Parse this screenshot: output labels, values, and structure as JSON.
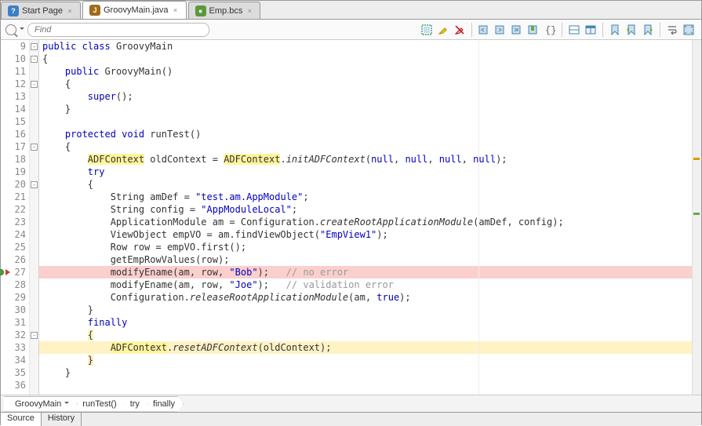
{
  "tabs": [
    {
      "label": "Start Page",
      "icon": "q",
      "active": false
    },
    {
      "label": "GroovyMain.java",
      "icon": "j",
      "active": true
    },
    {
      "label": "Emp.bcs",
      "icon": "g",
      "active": false
    }
  ],
  "find": {
    "placeholder": "Find"
  },
  "toolbar_icons": [
    "block-select",
    "highlight",
    "clear-highlight",
    "|",
    "nav-back",
    "nav-forward",
    "nav-last",
    "bookmark-toggle",
    "braces",
    "|",
    "split-h",
    "split-v",
    "|",
    "bookmark",
    "bm-prev",
    "bm-next",
    "|",
    "line-wrap",
    "fullscreen"
  ],
  "line_start": 9,
  "lines": [
    {
      "n": 9,
      "fold": "-",
      "html": "<span class='kw'>public</span> <span class='kw'>class</span> GroovyMain"
    },
    {
      "n": 10,
      "fold": "-",
      "html": "{"
    },
    {
      "n": 11,
      "html": "    <span class='kw'>public</span> GroovyMain()"
    },
    {
      "n": 12,
      "fold": "-",
      "html": "    {"
    },
    {
      "n": 13,
      "html": "        <span class='kw'>super</span>();"
    },
    {
      "n": 14,
      "html": "    }"
    },
    {
      "n": 15,
      "html": ""
    },
    {
      "n": 16,
      "html": "    <span class='kw'>protected</span> <span class='kw'>void</span> runTest()"
    },
    {
      "n": 17,
      "fold": "-",
      "html": "    {"
    },
    {
      "n": 18,
      "html": "        <span class='hl-y'>ADFContext</span> oldContext = <span class='hl-y'>ADFContext</span>.<span class='meth'>initADFContext</span>(<span class='kw'>null</span>, <span class='kw'>null</span>, <span class='kw'>null</span>, <span class='kw'>null</span>);"
    },
    {
      "n": 19,
      "html": "        <span class='kw'>try</span>"
    },
    {
      "n": 20,
      "fold": "-",
      "html": "        {"
    },
    {
      "n": 21,
      "html": "            String amDef = <span class='str'>\"test.am.AppModule\"</span>;"
    },
    {
      "n": 22,
      "html": "            String config = <span class='str'>\"AppModuleLocal\"</span>;"
    },
    {
      "n": 23,
      "html": "            ApplicationModule am = Configuration.<span class='meth'>createRootApplicationModule</span>(amDef, config);"
    },
    {
      "n": 24,
      "html": "            ViewObject empVO = am.findViewObject(<span class='str'>\"EmpView1\"</span>);"
    },
    {
      "n": 25,
      "html": "            Row row = empVO.first();"
    },
    {
      "n": 26,
      "html": "            getEmpRowValues(row);"
    },
    {
      "n": 27,
      "cls": "hl-r",
      "marks": [
        "bp",
        "arr"
      ],
      "html": "            modifyEname(am, row, <span class='str'>\"Bob\"</span>);   <span class='cm'>// no error</span>"
    },
    {
      "n": 28,
      "html": "            modifyEname(am, row, <span class='str'>\"Joe\"</span>);   <span class='cm'>// validation error</span>"
    },
    {
      "n": 29,
      "html": "            Configuration.<span class='meth'>releaseRootApplicationModule</span>(am, <span class='kw'>true</span>);"
    },
    {
      "n": 30,
      "html": "        }"
    },
    {
      "n": 31,
      "html": "        <span class='kw'>finally</span>"
    },
    {
      "n": 32,
      "fold": "-",
      "html": "        <span class='hl-brace-y'>{</span>"
    },
    {
      "n": 33,
      "cls": "hl-brace-y",
      "html": "            <span class='hl-y'>ADFContext</span>.<span class='meth'>resetADFContext</span>(oldContext);"
    },
    {
      "n": 34,
      "html": "        <span class='hl-brace-y'>}</span>"
    },
    {
      "n": 35,
      "html": "    }"
    },
    {
      "n": 36,
      "html": ""
    }
  ],
  "breadcrumb": [
    {
      "label": "GroovyMain",
      "dd": true
    },
    {
      "label": "runTest()",
      "dd": false
    },
    {
      "label": "try",
      "dd": false
    },
    {
      "label": "finally",
      "dd": false
    }
  ],
  "bottom_tabs": [
    {
      "label": "Source",
      "active": true
    },
    {
      "label": "History",
      "active": false
    }
  ]
}
